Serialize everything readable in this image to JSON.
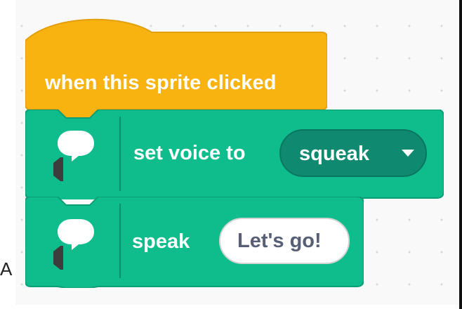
{
  "colors": {
    "event_block": "#f9b311",
    "tts_block": "#0fbd8c",
    "tts_block_shade": "#0da57a",
    "dropdown_fill": "#0f8a70",
    "input_fill": "#ffffff",
    "input_text": "#575e75",
    "workspace": "#f9f9f9"
  },
  "workspace": {
    "margin_mark": "A"
  },
  "event_block": {
    "label": "when this sprite clicked",
    "category": "Events"
  },
  "voice_block": {
    "label": "set voice to",
    "icon": "text-to-speech-icon",
    "dropdown": {
      "selected": "squeak",
      "arrow_icon": "dropdown-arrow-icon"
    }
  },
  "speak_block": {
    "label": "speak",
    "icon": "text-to-speech-icon",
    "input_value": "Let's go!"
  }
}
